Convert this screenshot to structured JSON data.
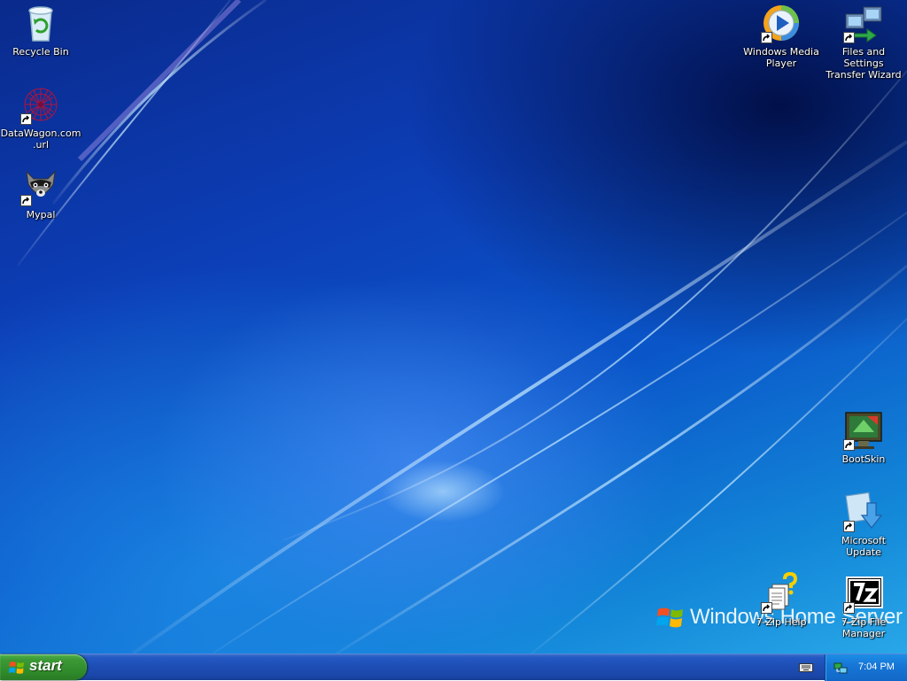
{
  "desktop": {
    "icons": [
      {
        "label": "Recycle Bin",
        "icon": "recycle-bin-icon"
      },
      {
        "label": "DataWagon.com.url",
        "icon": "datawagon-url-icon"
      },
      {
        "label": "Mypal",
        "icon": "mypal-browser-icon"
      },
      {
        "label": "Windows Media Player",
        "icon": "windows-media-player-icon"
      },
      {
        "label": "Files and Settings Transfer Wizard",
        "icon": "transfer-wizard-icon"
      },
      {
        "label": "BootSkin",
        "icon": "bootskin-icon"
      },
      {
        "label": "Microsoft Update",
        "icon": "microsoft-update-icon"
      },
      {
        "label": "7-Zip Help",
        "icon": "help-document-icon"
      },
      {
        "label": "7-Zip File Manager",
        "icon": "7zip-icon"
      }
    ],
    "wallpaper_branding": "Windows Home Server"
  },
  "taskbar": {
    "start_label": "start",
    "tray": {
      "clock": "7:04 PM"
    }
  },
  "colors": {
    "taskbar": "#2458c4",
    "start_button": "#3c9a36",
    "tray": "#1776d6"
  }
}
